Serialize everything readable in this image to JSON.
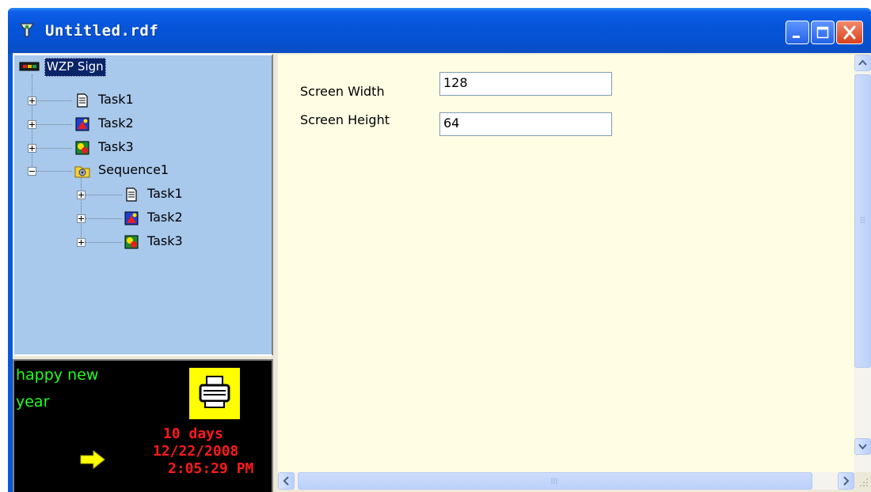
{
  "window": {
    "title": "Untitled.rdf",
    "controls": [
      "minimize",
      "maximize",
      "close"
    ]
  },
  "tree": {
    "root": "WZP Sign",
    "items": [
      {
        "label": "Task1",
        "icon": "text-task-icon",
        "expander": "+"
      },
      {
        "label": "Task2",
        "icon": "picture-task-icon",
        "expander": "+"
      },
      {
        "label": "Task3",
        "icon": "animation-task-icon",
        "expander": "+"
      },
      {
        "label": "Sequence1",
        "icon": "sequence-folder-icon",
        "expander": "-",
        "children": [
          {
            "label": "Task1",
            "icon": "text-task-icon",
            "expander": "+"
          },
          {
            "label": "Task2",
            "icon": "picture-task-icon",
            "expander": "+"
          },
          {
            "label": "Task3",
            "icon": "animation-task-icon",
            "expander": "+"
          }
        ]
      }
    ]
  },
  "preview": {
    "line1": "happy new",
    "line2": "year",
    "countdown": "10 days",
    "date": "12/22/2008",
    "time": "2:05:29 PM",
    "colors": {
      "background": "#000000",
      "green_text": "#22ff22",
      "red_text": "#ff1a1a",
      "icon_bg": "#ffff00"
    }
  },
  "properties": {
    "screen_width": {
      "label": "Screen Width",
      "value": "128"
    },
    "screen_height": {
      "label": "Screen Height",
      "value": "64"
    }
  },
  "scrollbars": {
    "vertical": {
      "up": "up-arrow-icon",
      "down": "down-arrow-icon"
    },
    "horizontal": {
      "left": "left-arrow-icon",
      "right": "right-arrow-icon"
    }
  }
}
